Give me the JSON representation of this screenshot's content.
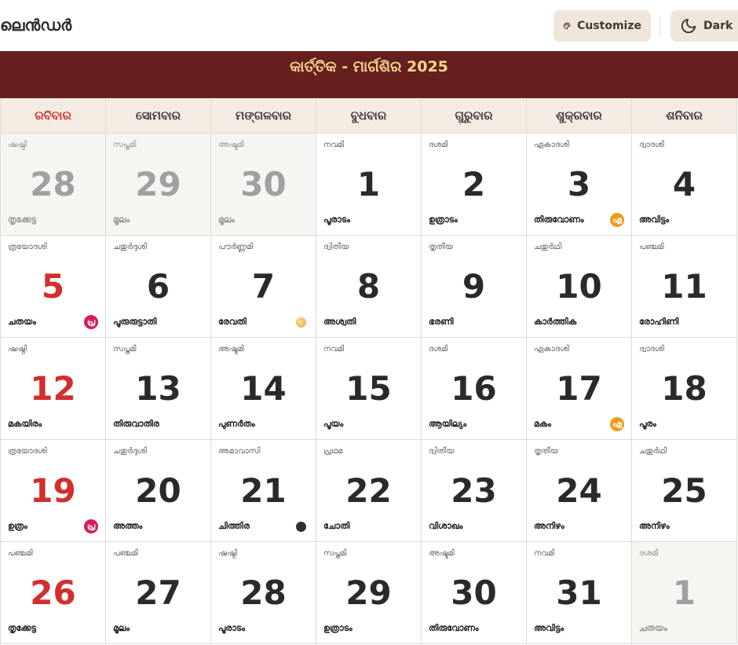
{
  "header": {
    "title": "ലെൻഡർ",
    "customize_label": "Customize",
    "dark_label": "Dark",
    "customize_icon": "palette-icon",
    "dark_icon": "moon-icon"
  },
  "banner": {
    "title": "କାର୍ତ୍ତିକ - ମାର୍ଗଶିର 2025"
  },
  "colors": {
    "banner_bg": "#661f1f",
    "banner_text": "#f7d98b",
    "sunday": "#d12f2f",
    "header_bg": "#f4ebe2",
    "button_bg": "#efe5d8"
  },
  "weekdays": [
    "ରବିବାର",
    "ସୋମବାର",
    "ମଙ୍ଗଳବାର",
    "ବୁଧବାର",
    "ଗୁରୁବାର",
    "ଶୁକ୍ରବାର",
    "ଶନିବାର"
  ],
  "weeks": [
    [
      {
        "day": "28",
        "tithi": "ഷഷ്ഠി",
        "star": "തൃക്കേട്ട",
        "other": true
      },
      {
        "day": "29",
        "tithi": "സപ്തമി",
        "star": "മൂലം",
        "other": true
      },
      {
        "day": "30",
        "tithi": "അഷ്ടമി",
        "star": "മൂലം",
        "other": true
      },
      {
        "day": "1",
        "tithi": "നവമി",
        "star": "പൂരാടം"
      },
      {
        "day": "2",
        "tithi": "ദശമി",
        "star": "ഉത്രാടം"
      },
      {
        "day": "3",
        "tithi": "ഏകാദശി",
        "star": "തിരുവോണം",
        "badge": "ekadashi",
        "badge_text": "ഏ"
      },
      {
        "day": "4",
        "tithi": "ദ്വാദശി",
        "star": "അവിട്ടം"
      }
    ],
    [
      {
        "day": "5",
        "tithi": "ത്രയോദശി",
        "star": "ചതയം",
        "badge": "pradosham",
        "badge_text": "പ്ര"
      },
      {
        "day": "6",
        "tithi": "ചതുർദ്ദശി",
        "star": "പൂരുരുട്ടാതി"
      },
      {
        "day": "7",
        "tithi": "പൗർണ്ണമി",
        "star": "രേവതി",
        "moon": "full"
      },
      {
        "day": "8",
        "tithi": "ദ്വിതീയ",
        "star": "അശ്വതി"
      },
      {
        "day": "9",
        "tithi": "തൃതീയ",
        "star": "ഭരണി"
      },
      {
        "day": "10",
        "tithi": "ചതുർഥി",
        "star": "കാർത്തിക"
      },
      {
        "day": "11",
        "tithi": "പഞ്ചമി",
        "star": "രോഹിണി"
      }
    ],
    [
      {
        "day": "12",
        "tithi": "ഷഷ്ഠി",
        "star": "മകയിരം"
      },
      {
        "day": "13",
        "tithi": "സപ്തമി",
        "star": "തിരുവാതിര"
      },
      {
        "day": "14",
        "tithi": "അഷ്ടമി",
        "star": "പുണർതം"
      },
      {
        "day": "15",
        "tithi": "നവമി",
        "star": "പൂയം"
      },
      {
        "day": "16",
        "tithi": "ദശമി",
        "star": "ആയില്യം"
      },
      {
        "day": "17",
        "tithi": "ഏകാദശി",
        "star": "മകം",
        "badge": "ekadashi",
        "badge_text": "ഏ"
      },
      {
        "day": "18",
        "tithi": "ദ്വാദശി",
        "star": "പൂരം"
      }
    ],
    [
      {
        "day": "19",
        "tithi": "ത്രയോദശി",
        "star": "ഉത്രം",
        "badge": "pradosham",
        "badge_text": "പ്ര"
      },
      {
        "day": "20",
        "tithi": "ചതുർദ്ദശി",
        "star": "അത്തം"
      },
      {
        "day": "21",
        "tithi": "അമാവാസി",
        "star": "ചിത്തിര",
        "moon": "new"
      },
      {
        "day": "22",
        "tithi": "പ്രഥമ",
        "star": "ചോതി"
      },
      {
        "day": "23",
        "tithi": "ദ്വിതീയ",
        "star": "വിശാഖം"
      },
      {
        "day": "24",
        "tithi": "തൃതീയ",
        "star": "അനിഴം"
      },
      {
        "day": "25",
        "tithi": "ചതുർഥി",
        "star": "അനിഴം"
      }
    ],
    [
      {
        "day": "26",
        "tithi": "പഞ്ചമി",
        "star": "തൃക്കേട്ട"
      },
      {
        "day": "27",
        "tithi": "പഞ്ചമി",
        "star": "മൂലം"
      },
      {
        "day": "28",
        "tithi": "ഷഷ്ഠി",
        "star": "പൂരാടം"
      },
      {
        "day": "29",
        "tithi": "സപ്തമി",
        "star": "ഉത്രാടം"
      },
      {
        "day": "30",
        "tithi": "അഷ്ടമി",
        "star": "തിരുവോണം"
      },
      {
        "day": "31",
        "tithi": "നവമി",
        "star": "അവിട്ടം"
      },
      {
        "day": "1",
        "tithi": "ദശമി",
        "star": "ചതയം",
        "other": true
      }
    ]
  ]
}
